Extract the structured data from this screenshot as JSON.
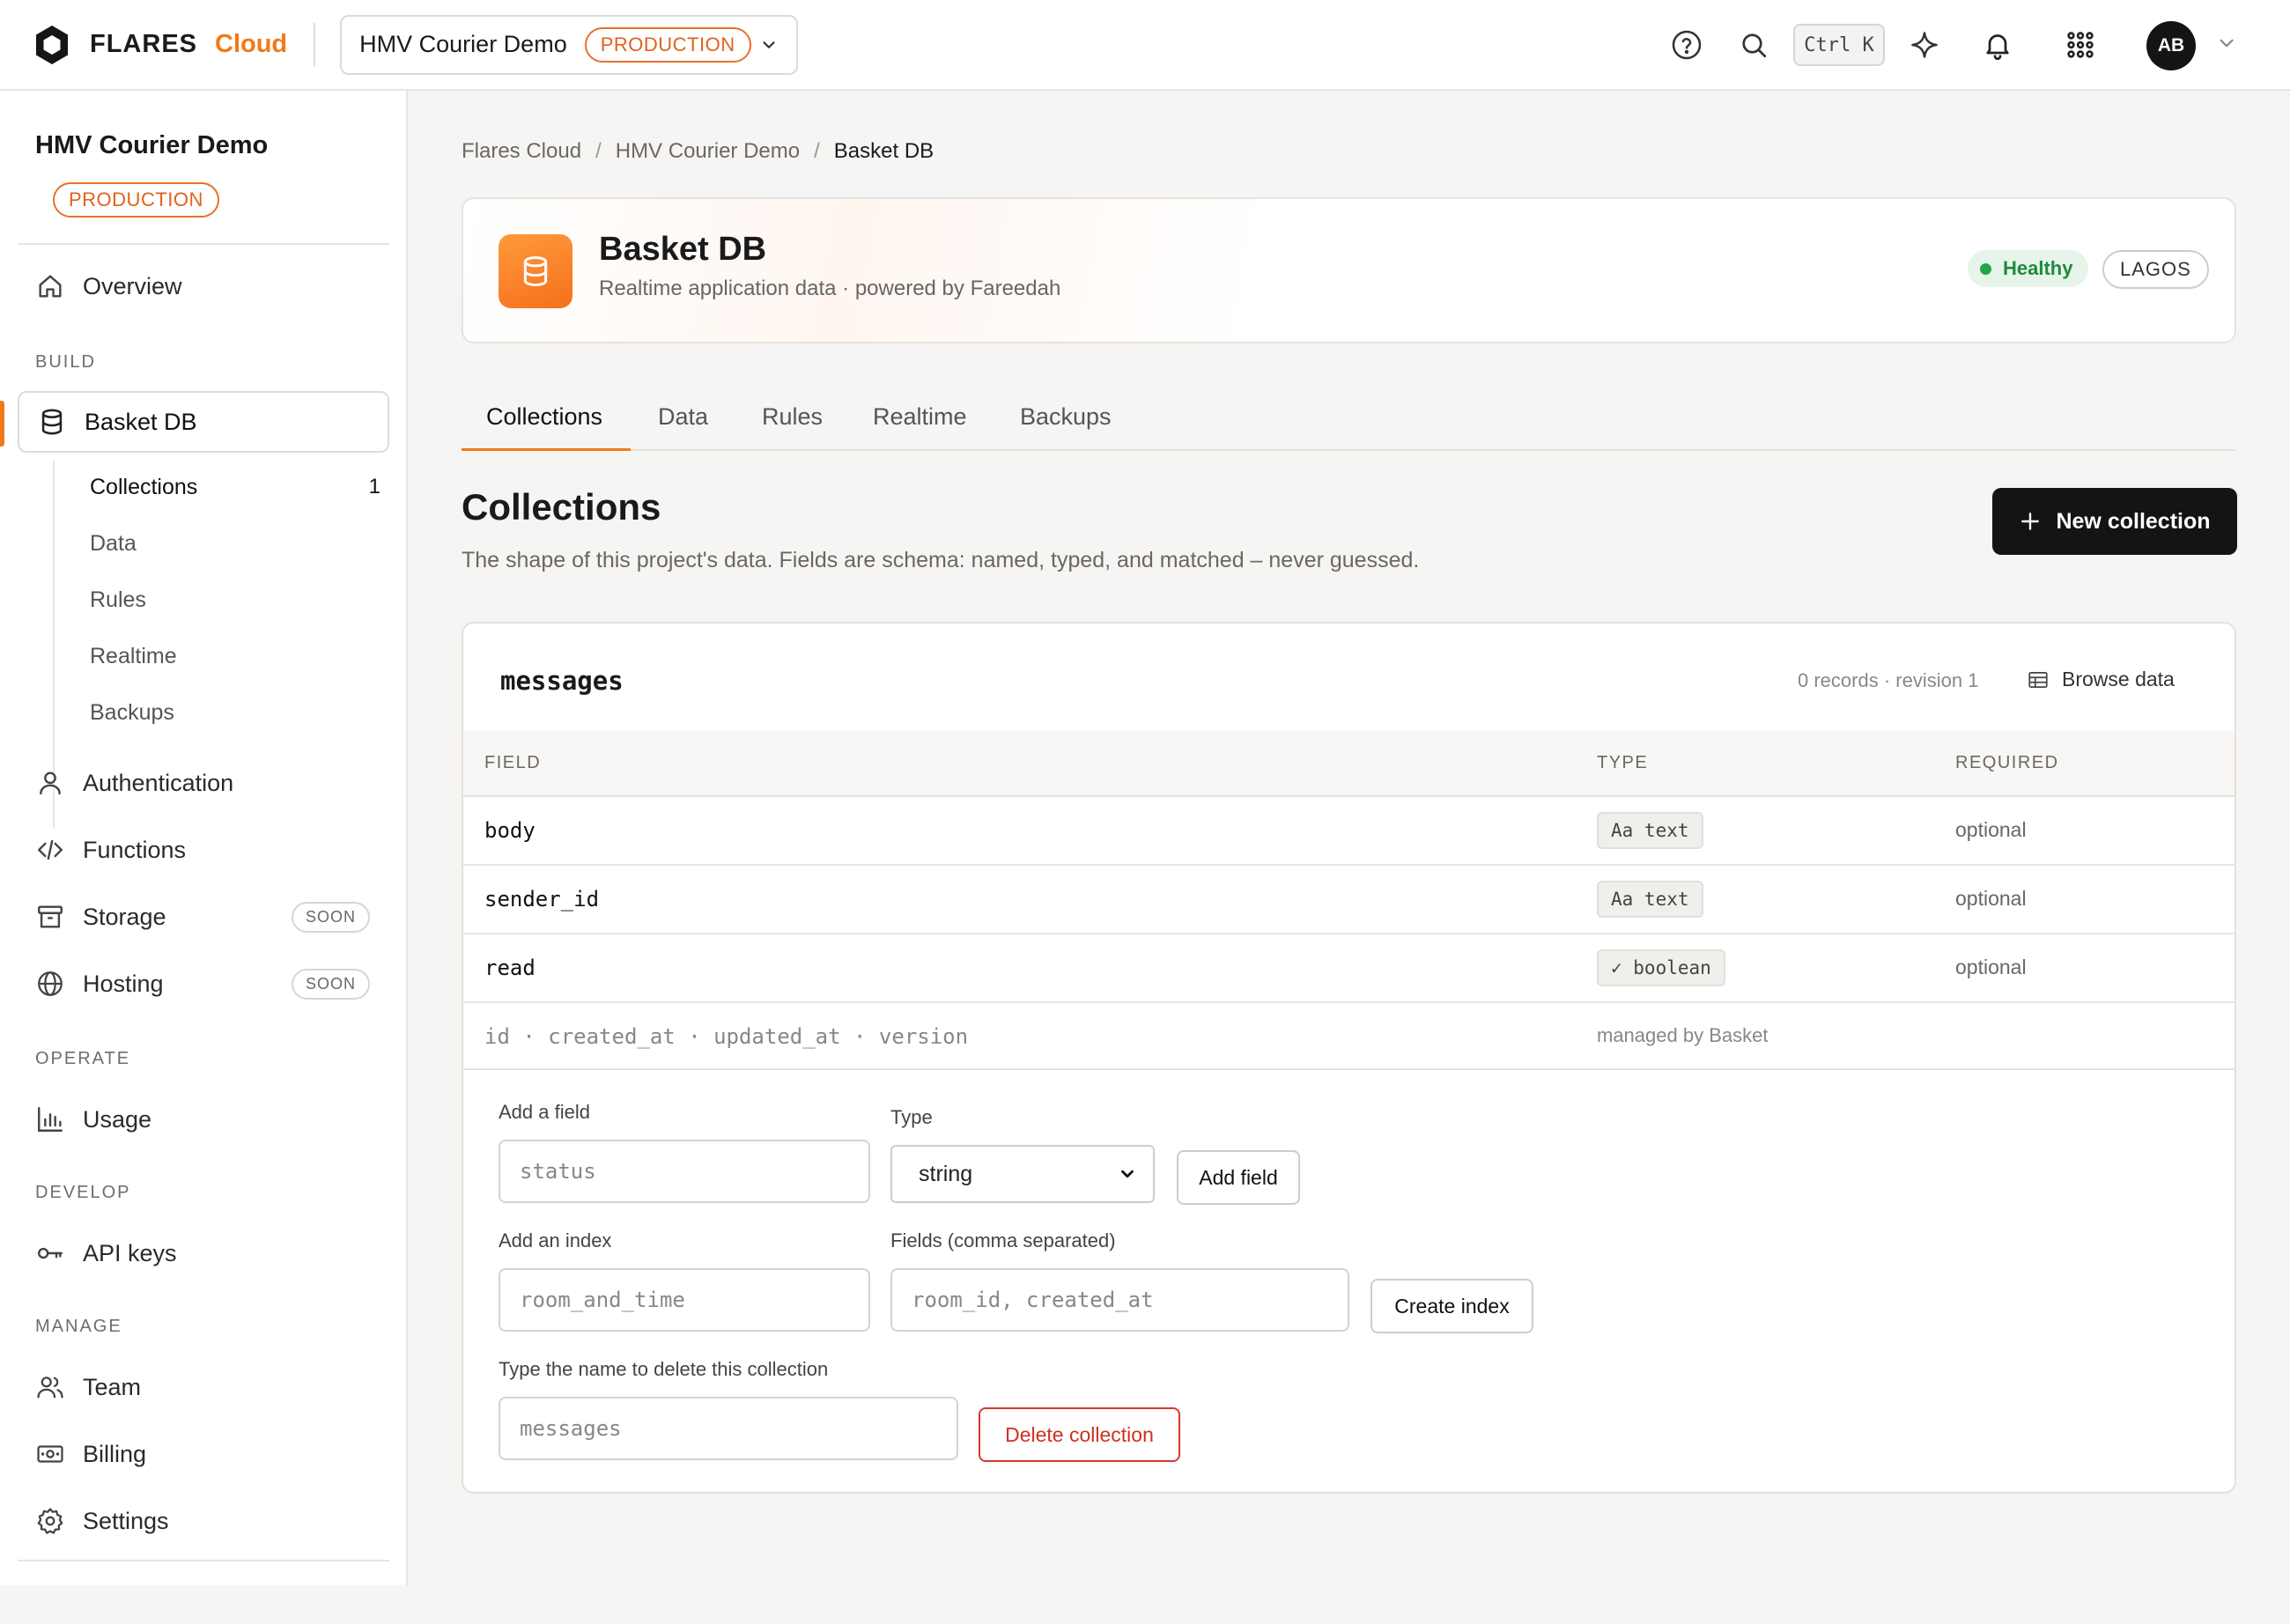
{
  "topbar": {
    "brand_name": "FLARES",
    "brand_suffix": "Cloud",
    "project_name": "HMV Courier Demo",
    "env_badge": "PRODUCTION",
    "shortcut": "Ctrl K",
    "avatar_initials": "AB"
  },
  "sidebar": {
    "project_title": "HMV Courier Demo",
    "env_badge": "PRODUCTION",
    "overview": "Overview",
    "section_build": "BUILD",
    "basket_db": "Basket DB",
    "sub_items": [
      {
        "label": "Collections",
        "count": "1"
      },
      {
        "label": "Data"
      },
      {
        "label": "Rules"
      },
      {
        "label": "Realtime"
      },
      {
        "label": "Backups"
      }
    ],
    "authentication": "Authentication",
    "functions": "Functions",
    "storage": "Storage",
    "hosting": "Hosting",
    "soon": "SOON",
    "section_operate": "OPERATE",
    "usage": "Usage",
    "section_develop": "DEVELOP",
    "api_keys": "API keys",
    "section_manage": "MANAGE",
    "team": "Team",
    "billing": "Billing",
    "settings": "Settings"
  },
  "breadcrumb": [
    "Flares Cloud",
    "HMV Courier Demo",
    "Basket DB"
  ],
  "hero": {
    "title": "Basket DB",
    "subtitle": "Realtime application data · powered by Fareedah",
    "status": "Healthy",
    "region": "LAGOS"
  },
  "tabs": [
    "Collections",
    "Data",
    "Rules",
    "Realtime",
    "Backups"
  ],
  "section": {
    "title": "Collections",
    "description": "The shape of this project's data. Fields are schema: named, typed, and matched – never guessed.",
    "new_button": "New collection"
  },
  "collection": {
    "name": "messages",
    "meta": "0 records · revision 1",
    "browse": "Browse data",
    "headers": [
      "FIELD",
      "TYPE",
      "REQUIRED"
    ],
    "fields": [
      {
        "name": "body",
        "type": "Aa text",
        "required": "optional"
      },
      {
        "name": "sender_id",
        "type": "Aa text",
        "required": "optional"
      },
      {
        "name": "read",
        "type": "✓ boolean",
        "required": "optional"
      }
    ],
    "managed_fields": "id · created_at · updated_at · version",
    "managed_note": "managed by Basket"
  },
  "forms": {
    "add_field_label": "Add a field",
    "add_field_placeholder": "status",
    "type_label": "Type",
    "type_value": "string",
    "add_field_button": "Add field",
    "add_index_label": "Add an index",
    "index_placeholder": "room_and_time",
    "fields_label": "Fields (comma separated)",
    "fields_placeholder": "room_id, created_at",
    "create_index_button": "Create index",
    "delete_label": "Type the name to delete this collection",
    "delete_placeholder": "messages",
    "delete_button": "Delete collection"
  },
  "colors": {
    "accent": "#f07a1a",
    "healthy": "#1f8a3d",
    "danger": "#d1301f"
  }
}
